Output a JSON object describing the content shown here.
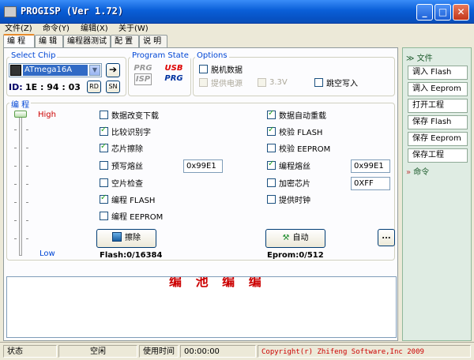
{
  "window": {
    "title": "PROGISP (Ver 1.72)"
  },
  "menu": [
    "文件(Z)",
    "命令(Y)",
    "编辑(X)",
    "关于(W)"
  ],
  "tabs": [
    "编 程",
    "编 辑",
    "编程器测试",
    "配 置",
    "说 明"
  ],
  "chip": {
    "group_title": "Select Chip",
    "selected": "ATmega16A",
    "id_label": "ID:",
    "id_value": "1E : 94 : 03",
    "rd_label": "RD",
    "sn_label": "SN"
  },
  "program_state": {
    "group_title": "Program State",
    "icon1_top": "PRG",
    "icon1_bottom": "ISP",
    "icon2_top": "USB",
    "icon2_bottom": "PRG"
  },
  "options": {
    "group_title": "Options",
    "offline": "脱机数据",
    "power": "提供电源",
    "voltage": "3.3V",
    "skip_blank": "跳空写入"
  },
  "program": {
    "group_title": "编 程",
    "slider_high": "High",
    "slider_low": "Low",
    "left_opts": [
      {
        "label": "数据改变下载",
        "checked": false
      },
      {
        "label": "比较识别字",
        "checked": true
      },
      {
        "label": "芯片擦除",
        "checked": true
      },
      {
        "label": "预写熔丝",
        "checked": false
      },
      {
        "label": "空片检查",
        "checked": false
      },
      {
        "label": "编程 FLASH",
        "checked": true
      },
      {
        "label": "编程 EEPROM",
        "checked": false
      }
    ],
    "right_opts": [
      {
        "label": "数据自动重载",
        "checked": true
      },
      {
        "label": "校验 FLASH",
        "checked": true
      },
      {
        "label": "校验 EEPROM",
        "checked": false
      },
      {
        "label": "编程熔丝",
        "checked": true
      },
      {
        "label": "加密芯片",
        "checked": false
      },
      {
        "label": "提供时钟",
        "checked": false
      }
    ],
    "prefuse_value": "0x99E1",
    "fuse_value": "0x99E1",
    "lock_value": "0XFF",
    "erase_label": "擦除",
    "auto_label": "自动",
    "more_label": "...",
    "flash_info": "Flash:0/16384",
    "eeprom_info": "Eprom:0/512"
  },
  "log": {
    "partial_text": "编 池 编 编"
  },
  "sidebar": {
    "file_header": "文件",
    "items": [
      "调入 Flash",
      "调入 Eeprom",
      "打开工程",
      "保存 Flash",
      "保存 Eeprom",
      "保存工程"
    ],
    "cmd_header": "命令"
  },
  "status": {
    "label": "状态",
    "state": "空闲",
    "time_label": "使用时间",
    "time_value": "00:00:00",
    "copyright": "Copyright(r) Zhifeng Software,Inc 2009"
  }
}
